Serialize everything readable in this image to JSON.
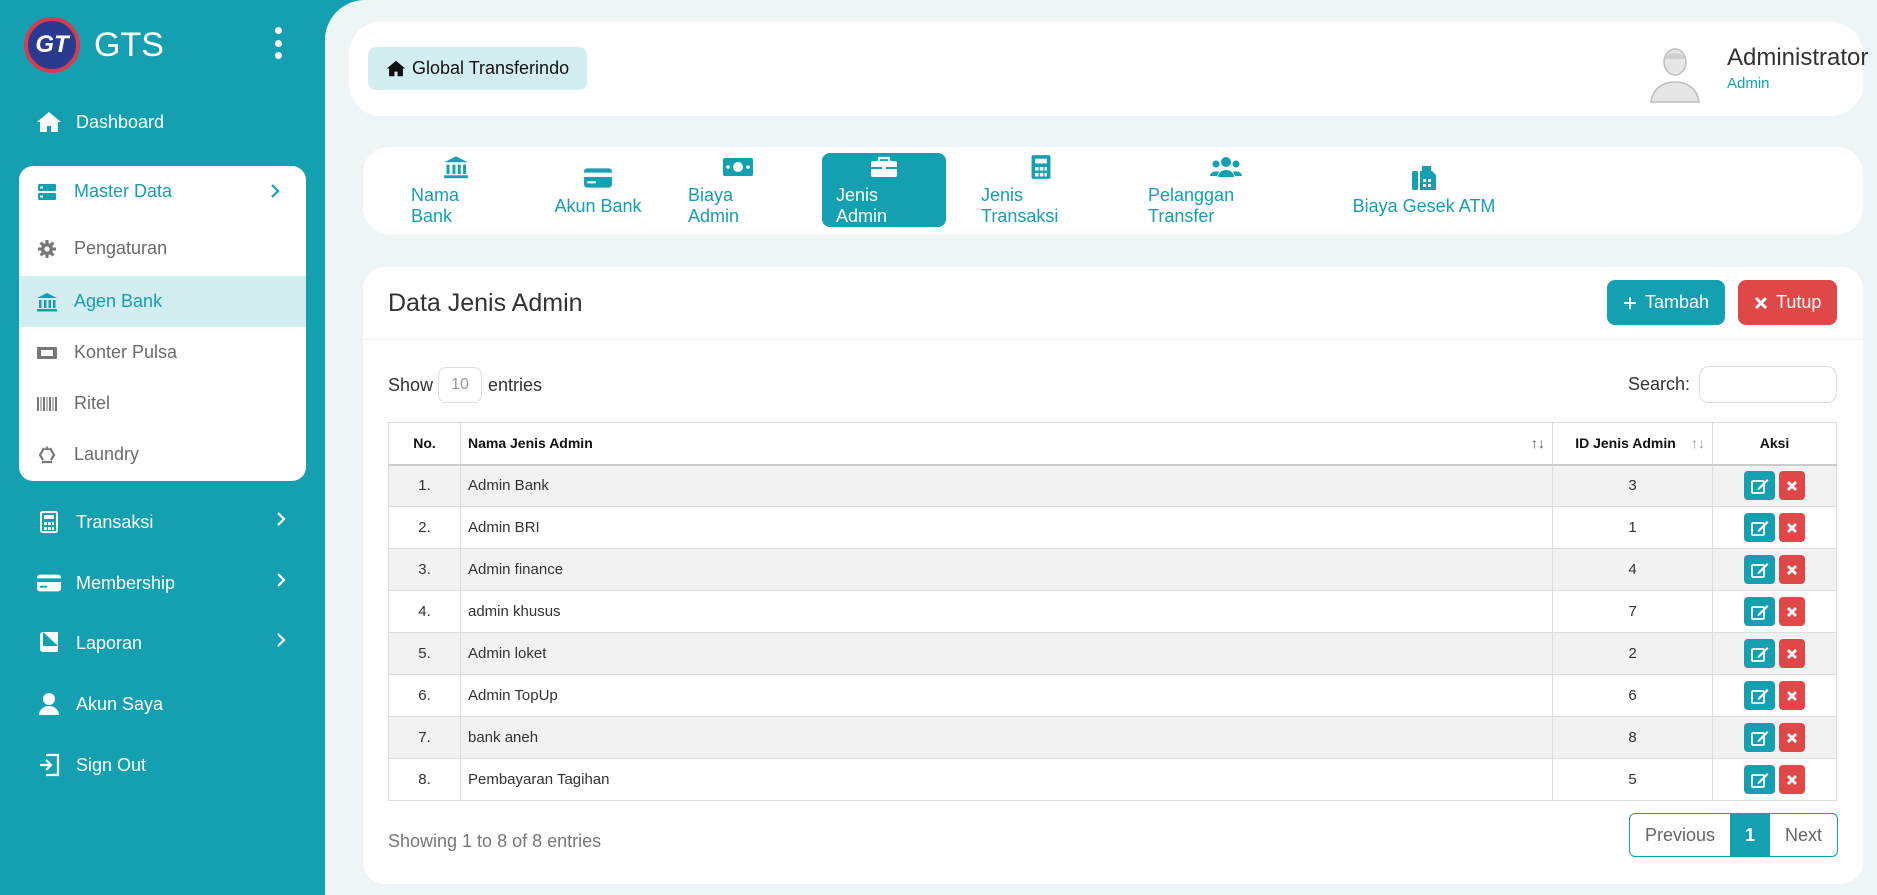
{
  "brand": {
    "name": "GTS",
    "logo_text": "GT"
  },
  "sidebar": {
    "items": [
      {
        "label": "Dashboard",
        "icon": "home-icon"
      },
      {
        "label": "Transaksi",
        "icon": "calculator-icon"
      },
      {
        "label": "Membership",
        "icon": "credit-card-icon"
      },
      {
        "label": "Laporan",
        "icon": "book-icon"
      },
      {
        "label": "Akun Saya",
        "icon": "user-icon"
      },
      {
        "label": "Sign Out",
        "icon": "sign-out-icon"
      }
    ],
    "master": {
      "label": "Master Data",
      "icon": "server-icon",
      "subitems": [
        {
          "label": "Pengaturan",
          "icon": "gear-icon"
        },
        {
          "label": "Agen Bank",
          "icon": "bank-icon",
          "active": true
        },
        {
          "label": "Konter Pulsa",
          "icon": "ticket-icon"
        },
        {
          "label": "Ritel",
          "icon": "barcode-icon"
        },
        {
          "label": "Laundry",
          "icon": "recycle-icon"
        }
      ]
    }
  },
  "header": {
    "breadcrumb": "Global Transferindo",
    "user_name": "Administrator",
    "user_role": "Admin"
  },
  "tabs": [
    {
      "label": "Nama Bank",
      "icon": "bank-icon"
    },
    {
      "label": "Akun Bank",
      "icon": "credit-card-icon"
    },
    {
      "label": "Biaya Admin",
      "icon": "money-bill-icon"
    },
    {
      "label": "Jenis Admin",
      "icon": "briefcase-icon",
      "active": true
    },
    {
      "label": "Jenis Transaksi",
      "icon": "calculator-icon"
    },
    {
      "label": "Pelanggan Transfer",
      "icon": "users-icon"
    },
    {
      "label": "Biaya Gesek ATM",
      "icon": "fax-icon"
    }
  ],
  "card": {
    "title": "Data Jenis Admin",
    "add_label": "Tambah",
    "close_label": "Tutup",
    "show_label": "Show",
    "entries_label": "entries",
    "page_length": "10",
    "search_label": "Search:",
    "search_value": ""
  },
  "table": {
    "columns": [
      "No.",
      "Nama Jenis Admin",
      "ID Jenis Admin",
      "Aksi"
    ],
    "rows": [
      {
        "no": "1.",
        "name": "Admin Bank",
        "id": "3"
      },
      {
        "no": "2.",
        "name": "Admin BRI",
        "id": "1"
      },
      {
        "no": "3.",
        "name": "Admin finance",
        "id": "4"
      },
      {
        "no": "4.",
        "name": "admin khusus",
        "id": "7"
      },
      {
        "no": "5.",
        "name": "Admin loket",
        "id": "2"
      },
      {
        "no": "6.",
        "name": "Admin TopUp",
        "id": "6"
      },
      {
        "no": "7.",
        "name": "bank aneh",
        "id": "8"
      },
      {
        "no": "8.",
        "name": "Pembayaran Tagihan",
        "id": "5"
      }
    ]
  },
  "footer": {
    "info": "Showing 1 to 8 of 8 entries",
    "prev_label": "Previous",
    "current_page": "1",
    "next_label": "Next"
  },
  "colors": {
    "accent": "#14a0b0",
    "danger": "#e04848",
    "active_bg": "#d3eef1"
  }
}
